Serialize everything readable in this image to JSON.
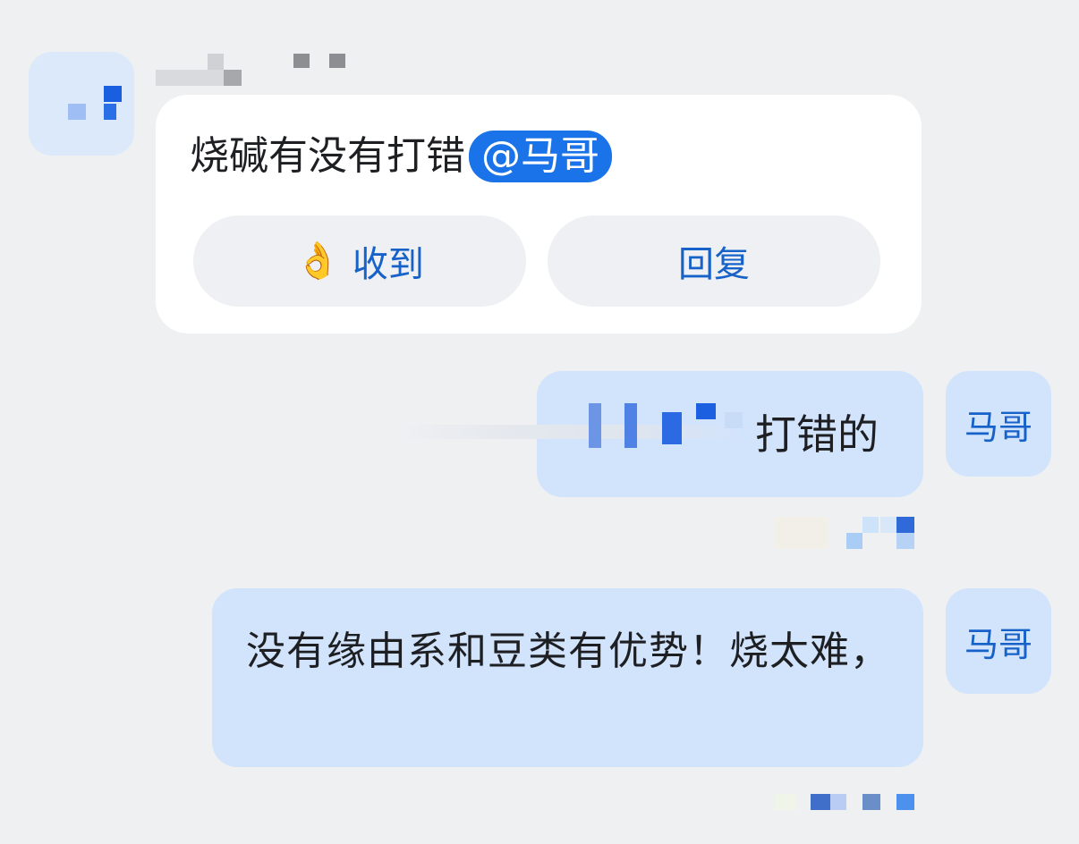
{
  "incoming": {
    "message": "烧碱有没有打错",
    "mention": "@马哥",
    "actions": {
      "ack_emoji": "👌",
      "ack_label": "收到",
      "reply_label": "回复"
    }
  },
  "outgoing": [
    {
      "text": "打错的",
      "avatar_label": "马哥"
    },
    {
      "text": "没有缘由系和豆类有优势！烧太难，",
      "avatar_label": "马哥"
    }
  ],
  "colors": {
    "background": "#eef0f2",
    "incoming_bubble": "#ffffff",
    "outgoing_bubble": "#d2e3fc",
    "mention_chip": "#1a73e8",
    "action_text": "#1762c9"
  }
}
